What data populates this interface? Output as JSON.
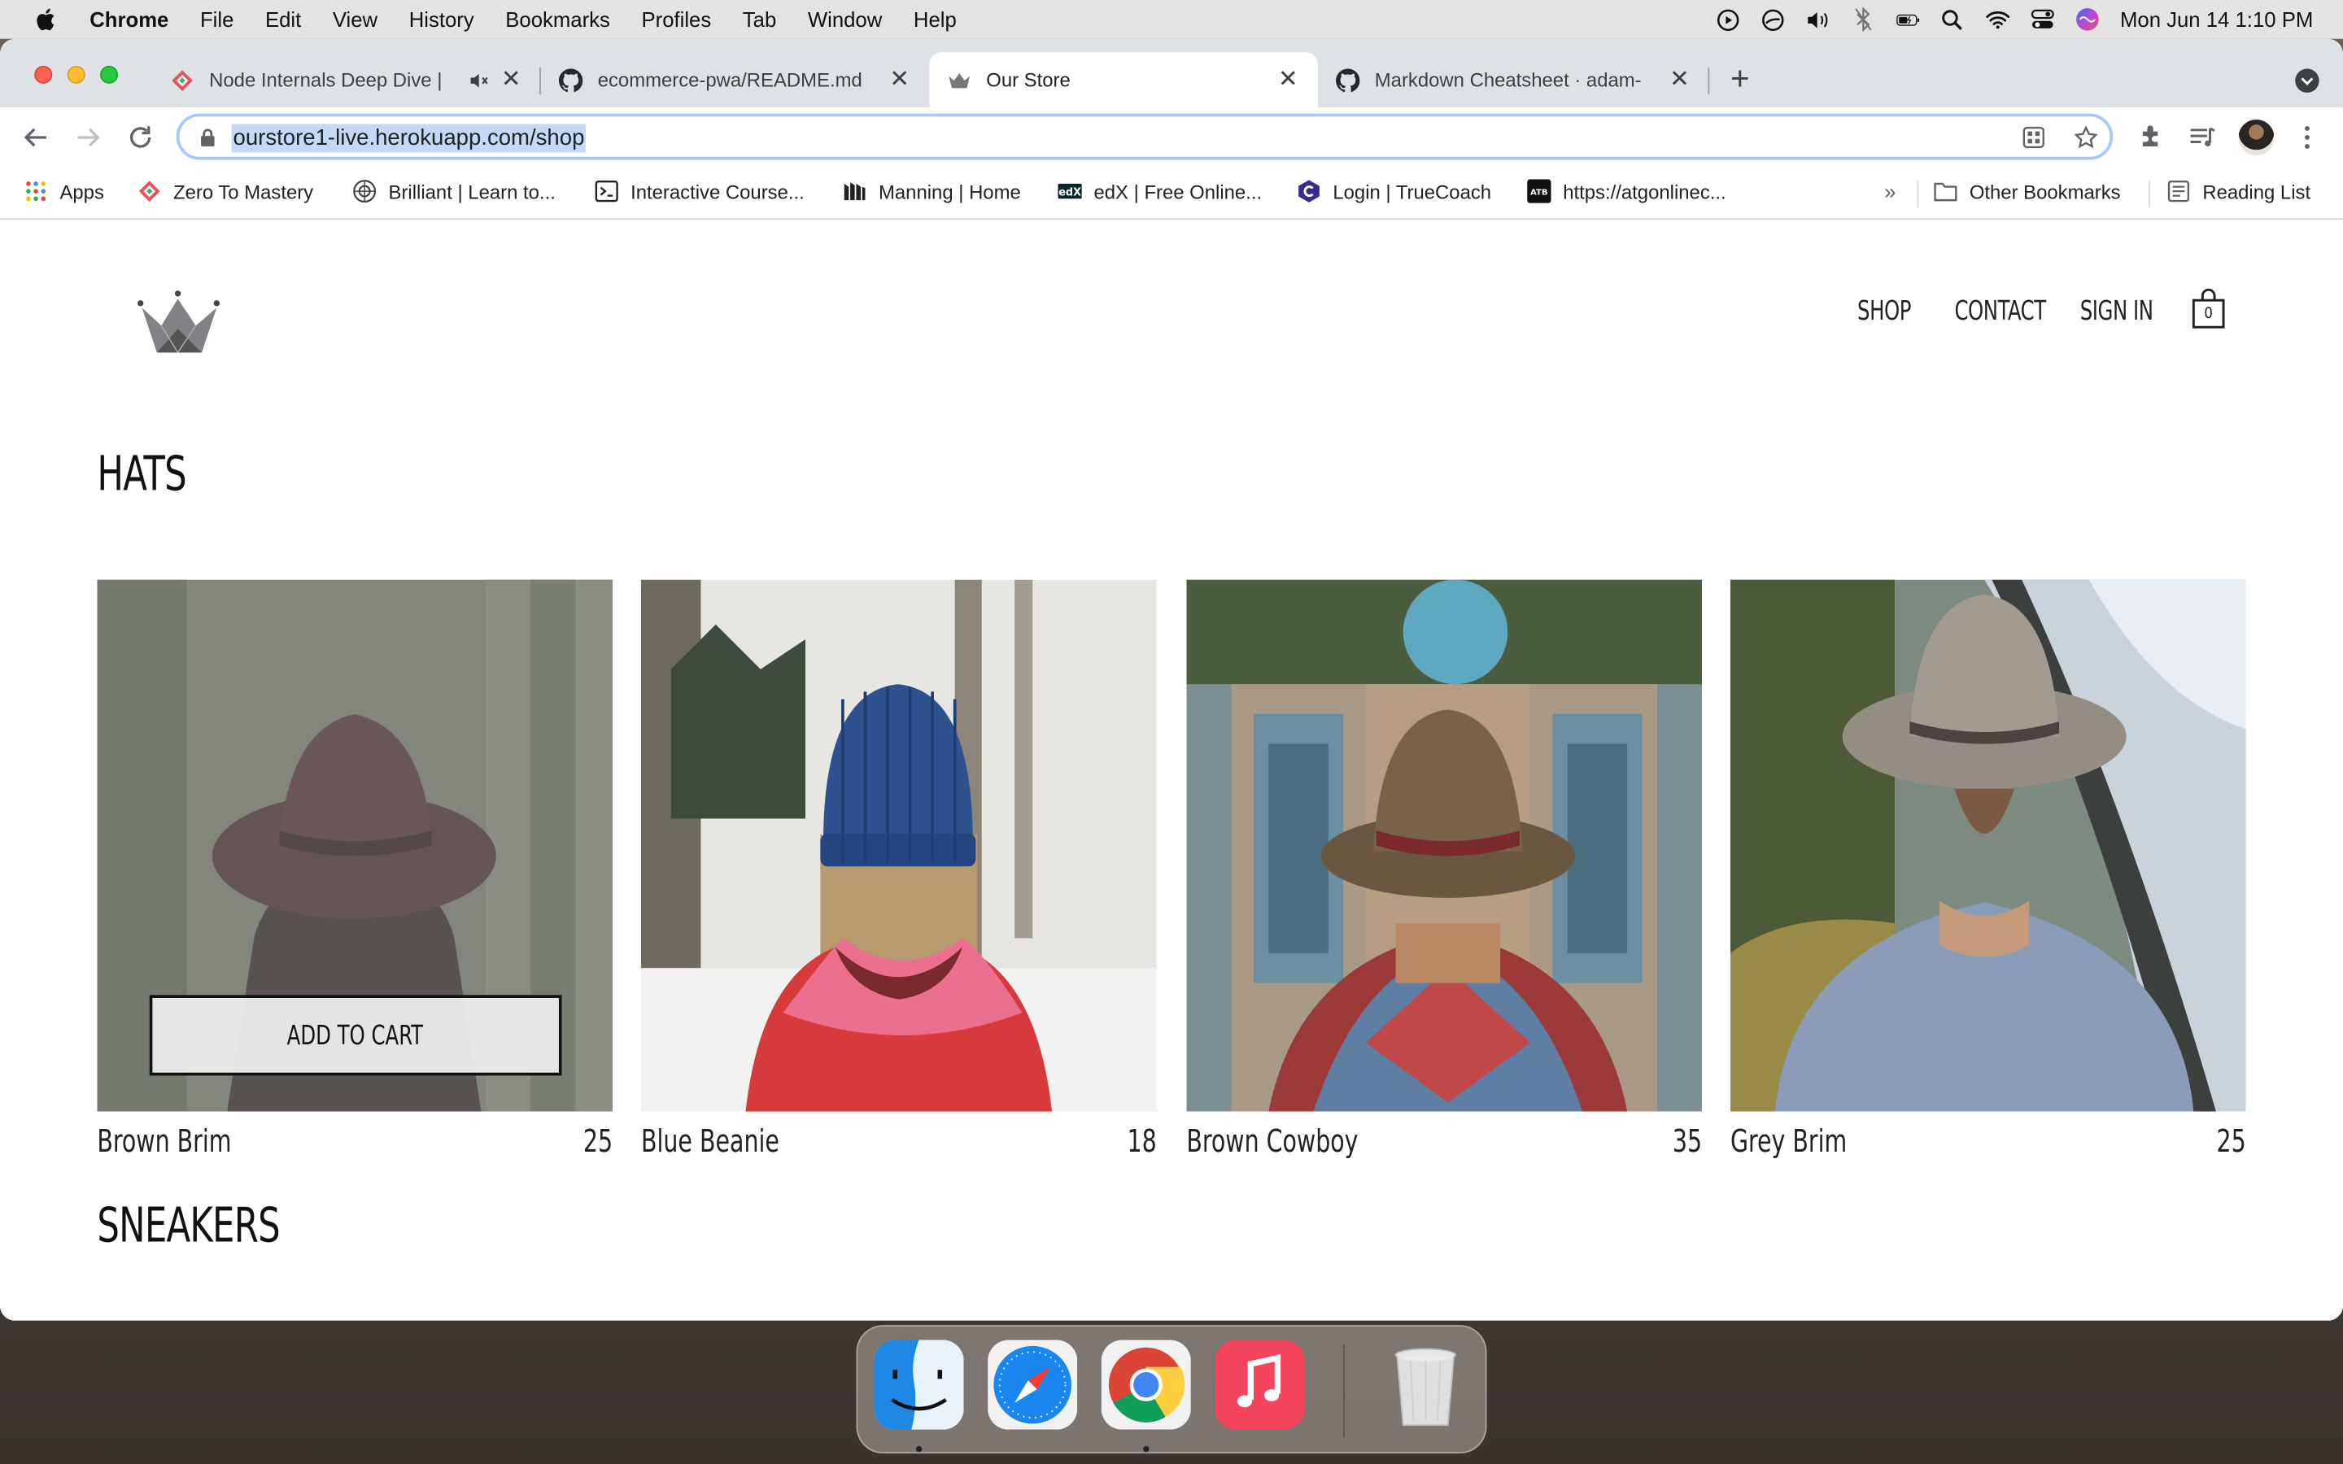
{
  "menubar": {
    "app": "Chrome",
    "items": [
      "File",
      "Edit",
      "View",
      "History",
      "Bookmarks",
      "Profiles",
      "Tab",
      "Window",
      "Help"
    ],
    "clock": "Mon Jun 14  1:10 PM"
  },
  "tabs": [
    {
      "title": "Node Internals Deep Dive |",
      "active": false,
      "icon": "zero-to-mastery-icon"
    },
    {
      "title": "ecommerce-pwa/README.md",
      "active": false,
      "icon": "github-icon"
    },
    {
      "title": "Our Store",
      "active": true,
      "icon": "crown-icon"
    },
    {
      "title": "Markdown Cheatsheet · adam-",
      "active": false,
      "icon": "github-icon"
    }
  ],
  "toolbar": {
    "url": "ourstore1-live.herokuapp.com/shop"
  },
  "bookmarks": [
    {
      "label": "Apps",
      "icon": "apps-grid-icon"
    },
    {
      "label": "Zero To Mastery",
      "icon": "zero-to-mastery-icon"
    },
    {
      "label": "Brilliant | Learn to...",
      "icon": "brilliant-icon"
    },
    {
      "label": "Interactive Course...",
      "icon": "terminal-icon"
    },
    {
      "label": "Manning | Home",
      "icon": "manning-icon"
    },
    {
      "label": "edX | Free Online...",
      "icon": "edx-icon"
    },
    {
      "label": "Login | TrueCoach",
      "icon": "truecoach-icon"
    },
    {
      "label": "https://atgonlinec...",
      "icon": "atb-icon"
    }
  ],
  "bookmarks_more": "»",
  "other_bookmarks": "Other Bookmarks",
  "reading_list": "Reading List",
  "store": {
    "nav": {
      "shop": "SHOP",
      "contact": "CONTACT",
      "signin": "SIGN IN"
    },
    "cart_count": "0",
    "sections": [
      {
        "title": "HATS",
        "items": [
          {
            "name": "Brown Brim",
            "price": "25"
          },
          {
            "name": "Blue Beanie",
            "price": "18"
          },
          {
            "name": "Brown Cowboy",
            "price": "35"
          },
          {
            "name": "Grey Brim",
            "price": "25"
          }
        ]
      },
      {
        "title": "SNEAKERS"
      }
    ],
    "add_to_cart": "ADD TO CART"
  },
  "dock": [
    "Finder",
    "Safari",
    "Google Chrome",
    "Music",
    "Trash"
  ]
}
